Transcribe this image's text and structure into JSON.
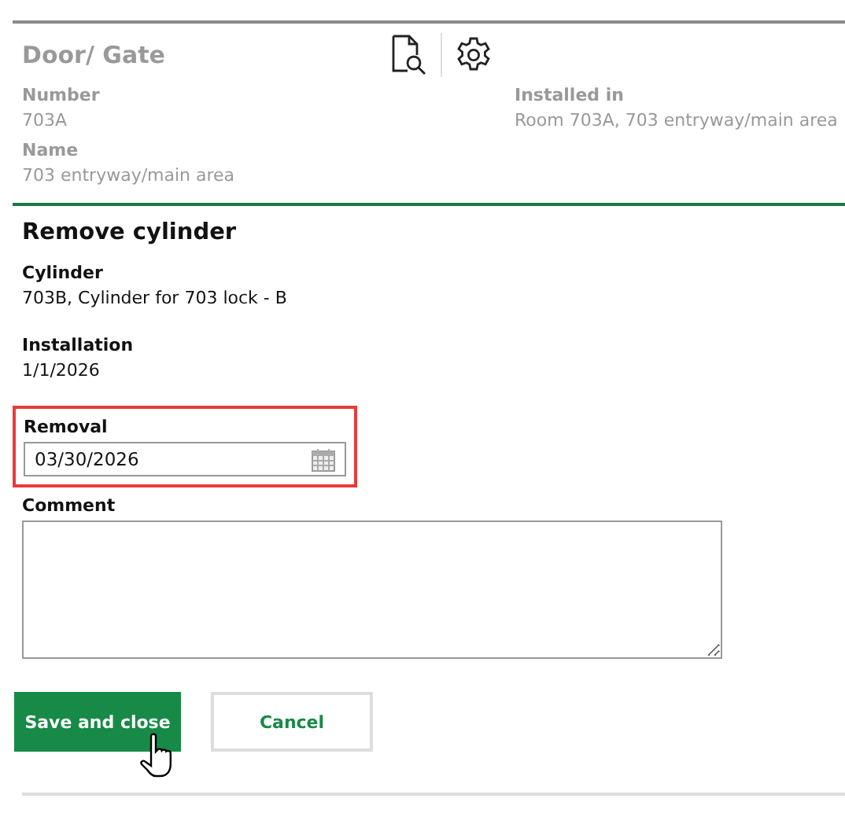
{
  "header": {
    "title": "Door/ Gate",
    "fields": [
      {
        "label": "Number",
        "value": "703A"
      },
      {
        "label": "Installed in",
        "value": "Room 703A, 703 entryway/main area"
      },
      {
        "label": "Name",
        "value": "703 entryway/main area"
      }
    ]
  },
  "form": {
    "title": "Remove cylinder",
    "info": [
      {
        "label": "Cylinder",
        "value": "703B, Cylinder for 703 lock - B"
      },
      {
        "label": "Installation",
        "value": "1/1/2026"
      }
    ],
    "removal": {
      "label": "Removal",
      "value": "03/30/2026",
      "highlighted": true
    },
    "comment": {
      "label": "Comment"
    },
    "buttons": [
      {
        "label": "Save and close",
        "kind": "primary"
      },
      {
        "label": "Cancel",
        "kind": "secondary"
      }
    ]
  }
}
